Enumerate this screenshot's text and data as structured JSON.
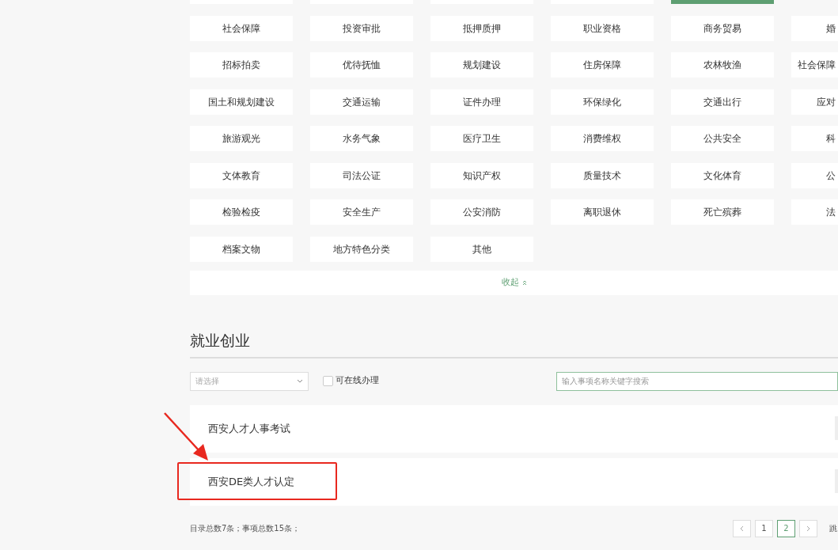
{
  "top_row": [
    {
      "selected": false
    },
    {
      "selected": false
    },
    {
      "selected": false
    },
    {
      "selected": false
    },
    {
      "selected": true
    }
  ],
  "categories": [
    [
      "社会保障",
      "投资审批",
      "抵押质押",
      "职业资格",
      "商务贸易",
      "婚"
    ],
    [
      "招标拍卖",
      "优待抚恤",
      "规划建设",
      "住房保障",
      "农林牧渔",
      "社会保障"
    ],
    [
      "国土和规划建设",
      "交通运输",
      "证件办理",
      "环保绿化",
      "交通出行",
      "应对"
    ],
    [
      "旅游观光",
      "水务气象",
      "医疗卫生",
      "消费维权",
      "公共安全",
      "科"
    ],
    [
      "文体教育",
      "司法公证",
      "知识产权",
      "质量技术",
      "文化体育",
      "公"
    ],
    [
      "检验检疫",
      "安全生产",
      "公安消防",
      "离职退休",
      "死亡殡葬",
      "法"
    ],
    [
      "档案文物",
      "地方特色分类",
      "其他"
    ]
  ],
  "collapse": {
    "label": "收起"
  },
  "section": {
    "title": "就业创业"
  },
  "filters": {
    "select_placeholder": "请选择",
    "online": {
      "label": "可在线办理",
      "checked": false
    },
    "search_placeholder": "输入事项名称关键字搜索"
  },
  "items": [
    {
      "title": "西安人才人事考试",
      "highlighted": false
    },
    {
      "title": "西安DE类人才认定",
      "highlighted": true
    }
  ],
  "footer": {
    "summary": "目录总数7条；事项总数15条；",
    "pages": [
      {
        "label": "1",
        "selected": false
      },
      {
        "label": "2",
        "selected": true
      }
    ],
    "jump_label": "跳"
  }
}
